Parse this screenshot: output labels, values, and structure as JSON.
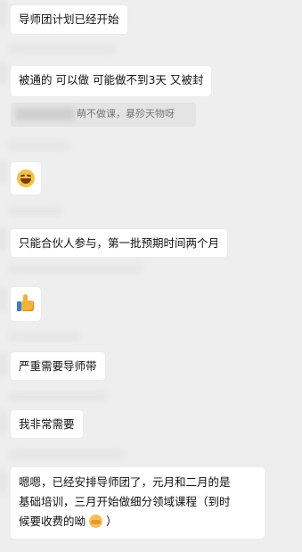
{
  "messages": [
    {
      "text": "导师团计划已经开始"
    },
    {
      "text": "被通的 可以做 可能做不到3天 又被封"
    },
    {
      "quote": "萌不做课，暴殄天物呀"
    },
    {
      "emoji": "grinning-squint-emoji"
    },
    {
      "text": "只能合伙人参与，第一批预期时间两个月"
    },
    {
      "emoji": "thumbs-up-emoji"
    },
    {
      "text": "严重需要导师带"
    },
    {
      "text": "我非常需要"
    },
    {
      "line1": "嗯嗯，已经安排导师团了，元月和二月的是",
      "line2": "基础培训，三月开始做细分领域课程（到时",
      "line3_pre": "候要收费的呦",
      "line3_emoji": "shushing-face-emoji",
      "line3_post": "）"
    }
  ],
  "colors": {
    "background": "#eeeeee",
    "bubble": "#ffffff",
    "quote_bg": "#e4e4e4",
    "quote_text": "#777777"
  }
}
